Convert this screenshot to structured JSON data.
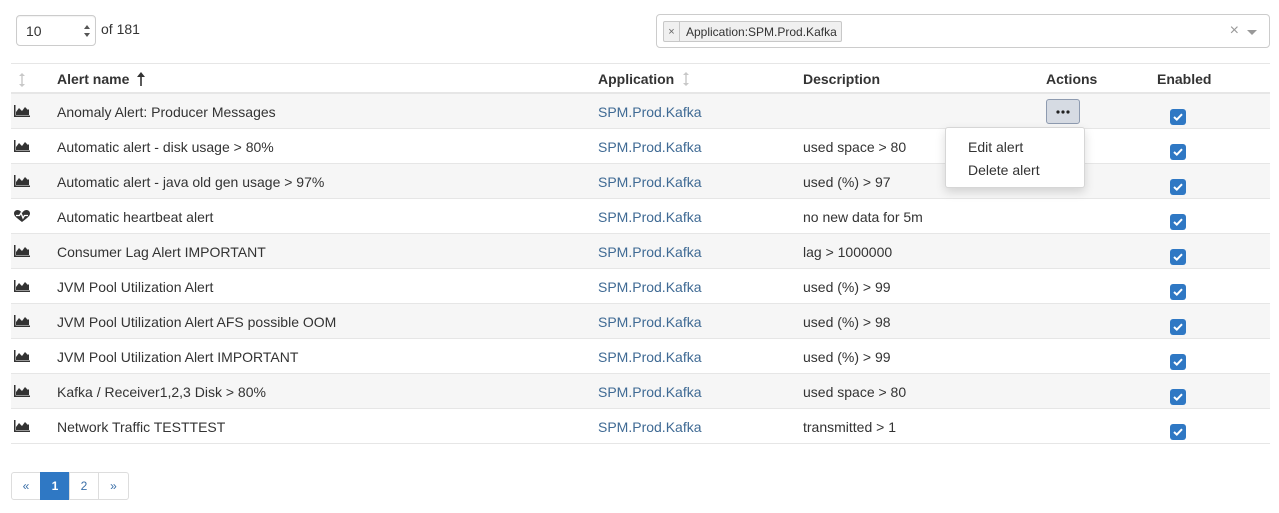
{
  "top": {
    "page_size": "10",
    "of_count": "of 181",
    "filter_chip": "Application:SPM.Prod.Kafka",
    "chip_remove": "×",
    "clear_all": "×"
  },
  "columns": {
    "name": "Alert name",
    "application": "Application",
    "description": "Description",
    "actions": "Actions",
    "enabled": "Enabled"
  },
  "rows": [
    {
      "icon": "chart-icon",
      "name": "Anomaly Alert: Producer Messages",
      "application": "SPM.Prod.Kafka",
      "description": "",
      "enabled": true
    },
    {
      "icon": "chart-icon",
      "name": "Automatic alert - disk usage > 80%",
      "application": "SPM.Prod.Kafka",
      "description": "used space > 80",
      "enabled": true
    },
    {
      "icon": "chart-icon",
      "name": "Automatic alert - java old gen usage > 97%",
      "application": "SPM.Prod.Kafka",
      "description": "used (%) > 97",
      "enabled": true
    },
    {
      "icon": "heartbeat-icon",
      "name": "Automatic heartbeat alert",
      "application": "SPM.Prod.Kafka",
      "description": "no new data for 5m",
      "enabled": true
    },
    {
      "icon": "chart-icon",
      "name": "Consumer Lag Alert IMPORTANT",
      "application": "SPM.Prod.Kafka",
      "description": "lag > 1000000",
      "enabled": true
    },
    {
      "icon": "chart-icon",
      "name": "JVM Pool Utilization Alert",
      "application": "SPM.Prod.Kafka",
      "description": "used (%) > 99",
      "enabled": true
    },
    {
      "icon": "chart-icon",
      "name": "JVM Pool Utilization Alert AFS possible OOM",
      "application": "SPM.Prod.Kafka",
      "description": "used (%) > 98",
      "enabled": true
    },
    {
      "icon": "chart-icon",
      "name": "JVM Pool Utilization Alert IMPORTANT",
      "application": "SPM.Prod.Kafka",
      "description": "used (%) > 99",
      "enabled": true
    },
    {
      "icon": "chart-icon",
      "name": "Kafka / Receiver1,2,3 Disk > 80%",
      "application": "SPM.Prod.Kafka",
      "description": "used space > 80",
      "enabled": true
    },
    {
      "icon": "chart-icon",
      "name": "Network Traffic TESTTEST",
      "application": "SPM.Prod.Kafka",
      "description": "transmitted > 1",
      "enabled": true
    }
  ],
  "actions_menu": {
    "edit": "Edit alert",
    "delete": "Delete alert"
  },
  "pagination": {
    "prev": "«",
    "pages": [
      "1",
      "2"
    ],
    "current": "1",
    "next": "»"
  },
  "colors": {
    "accent": "#2f78c4",
    "link": "#3f6a94"
  }
}
